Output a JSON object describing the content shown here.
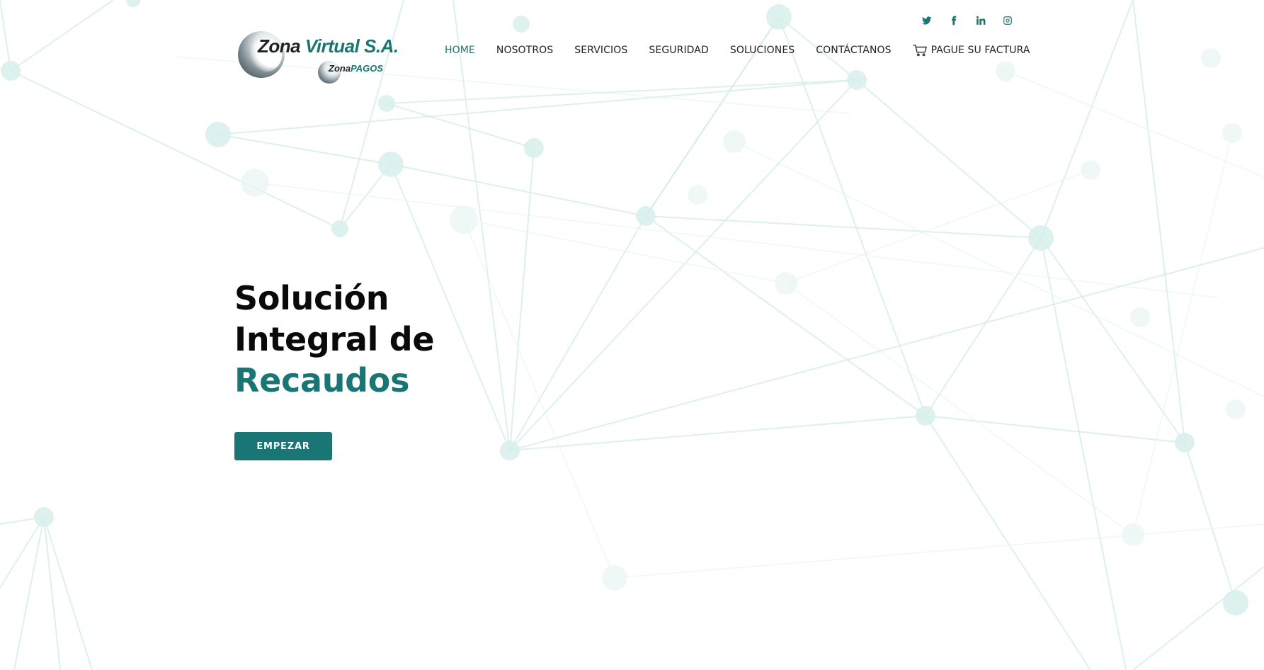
{
  "brand": {
    "logo_word_1": "Zona",
    "logo_word_2": "Virtual S.A.",
    "sub_word_1": "Zona",
    "sub_word_2": "PAGOS",
    "accent_color": "#1a7674",
    "text_color": "#0a0a0a"
  },
  "social": [
    {
      "icon": "twitter-icon"
    },
    {
      "icon": "facebook-icon"
    },
    {
      "icon": "linkedin-icon"
    },
    {
      "icon": "instagram-icon"
    }
  ],
  "nav": {
    "items": [
      {
        "label": "HOME",
        "active": true
      },
      {
        "label": "NOSOTROS"
      },
      {
        "label": "SERVICIOS"
      },
      {
        "label": "SEGURIDAD"
      },
      {
        "label": "SOLUCIONES"
      },
      {
        "label": "CONTÁCTANOS"
      },
      {
        "label": "PAGUE SU FACTURA",
        "icon": "cart-icon"
      }
    ]
  },
  "hero": {
    "line_1": "Solución",
    "line_2": "Integral de",
    "line_3": "Recaudos",
    "cta_label": "EMPEZAR"
  }
}
